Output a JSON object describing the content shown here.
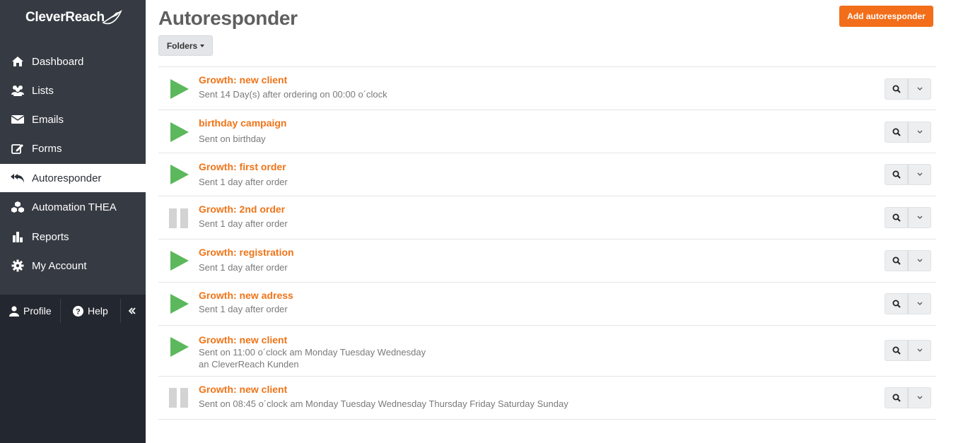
{
  "brand": {
    "name": "CleverReach",
    "accent": "#f26e1a"
  },
  "page": {
    "title": "Autoresponder"
  },
  "toolbar": {
    "add_label": "Add autoresponder",
    "folders_label": "Folders"
  },
  "sidebar": {
    "items": [
      {
        "label": "Dashboard",
        "icon": "home-icon"
      },
      {
        "label": "Lists",
        "icon": "users-icon"
      },
      {
        "label": "Emails",
        "icon": "envelope-icon"
      },
      {
        "label": "Forms",
        "icon": "edit-icon"
      },
      {
        "label": "Autoresponder",
        "icon": "reply-all-icon",
        "active": true
      },
      {
        "label": "Automation THEA",
        "icon": "cubes-icon"
      },
      {
        "label": "Reports",
        "icon": "bar-chart-icon"
      },
      {
        "label": "My Account",
        "icon": "gear-icon"
      }
    ],
    "footer": {
      "profile_label": "Profile",
      "help_label": "Help"
    }
  },
  "autoresponders": [
    {
      "title": "Growth: new client",
      "lines": [
        "Sent 14 Day(s) after ordering on 00:00 o´clock"
      ],
      "status": "active"
    },
    {
      "title": "birthday campaign",
      "lines": [
        "Sent on birthday"
      ],
      "status": "active"
    },
    {
      "title": "Growth: first order",
      "lines": [
        "Sent 1 day after order"
      ],
      "status": "active"
    },
    {
      "title": "Growth: 2nd order",
      "lines": [
        "Sent 1 day after order"
      ],
      "status": "paused"
    },
    {
      "title": "Growth: registration",
      "lines": [
        "Sent 1 day after order"
      ],
      "status": "active"
    },
    {
      "title": "Growth: new adress",
      "lines": [
        "Sent 1 day after order"
      ],
      "status": "active"
    },
    {
      "title": "Growth: new client",
      "lines": [
        "Sent on 11:00 o´clock am Monday Tuesday Wednesday",
        "an CleverReach Kunden"
      ],
      "status": "active"
    },
    {
      "title": "Growth: new client",
      "lines": [
        "Sent on 08:45 o´clock am Monday Tuesday Wednesday Thursday Friday Saturday Sunday"
      ],
      "status": "paused"
    }
  ]
}
